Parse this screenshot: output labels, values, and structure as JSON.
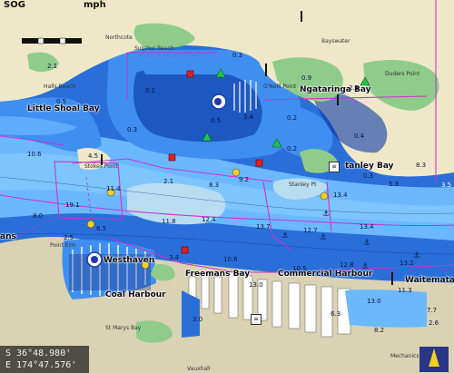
{
  "header": {
    "sog_label": "SOG",
    "speed_unit": "mph"
  },
  "position": {
    "lat": "S  36°48.980'",
    "lon": "E 174°47.576'"
  },
  "places": {
    "northcote": "Northcote",
    "sulphur_beach": "Sulphur Beach",
    "bayswater": "Bayswater",
    "halls_beach": "Halls Beach",
    "little_shoal_bay": "Little Shoal Bay",
    "stokes_point": "Stokes Point",
    "ngataringa_bay": "Ngataringa Bay",
    "duders_point": "Duders Point",
    "stanley_bay": "tanley Bay",
    "stanley_point": "Stanley Pt",
    "point_erin": "Point Erin",
    "westhaven": "Westhaven",
    "freemans_bay": "Freemans Bay",
    "commercial_harbour": "Commercial Harbour",
    "waitemata": "Waitemata",
    "coal_harbour": "Coal Harbour",
    "st_marys_bay": "St Marys Bay",
    "mechanics_bay": "Mechanics",
    "vauxhall": "Vauxhall",
    "ans": "ans",
    "oneill_point": "O'Neill Point"
  },
  "depths": {
    "d_2_1": "2.1",
    "d_0_3": "0.3",
    "d_0_9": "0.9",
    "d_0_1": "0.1",
    "d_2_3": "2.3",
    "d_0_5a": "0.5",
    "d_0_5b": "0.5",
    "d_0_3b": "0.3",
    "d_3_4": "3.4",
    "d_0_2a": "0.2",
    "d_0_2b": "0.2",
    "d_0_4": "0.4",
    "d_10_6": "10.6",
    "d_4_5": "4.5",
    "d_2_1b": "2.1",
    "d_8_3": "8.3",
    "d_9_2": "9.2",
    "d_5_3": "5.3",
    "d_3_5": "3.5",
    "d_11_4": "11.4",
    "d_13_4": "13.4",
    "d_19_1": "19.1",
    "d_8_0": "8.0",
    "d_11_8": "11.8",
    "d_12_4": "12.4",
    "d_13_7": "13.7",
    "d_12_7": "12.7",
    "d_13_4b": "13.4",
    "d_6_5": "6.5",
    "d_3_4b": "3.4",
    "d_10_6b": "10.6",
    "d_10_5": "10.5",
    "d_12_8": "12.8",
    "d_13_2": "13.2",
    "d_13_0": "13.0",
    "d_11_3": "11.3",
    "d_13_0b": "13.0",
    "d_3_0": "3.0",
    "d_6_3": "6.3",
    "d_7_7": "7.7",
    "d_8_2": "8.2",
    "d_2_6": "2.6",
    "d_8_3b": "8.3",
    "d_2_5": "2.5",
    "d_0_3c": "0.3"
  },
  "colors": {
    "land": "#efe8c8",
    "urban": "#d9d2b3",
    "park": "#8fcc8a",
    "deep_water": "#2a6fd8",
    "mid_water": "#3f8ff0",
    "channel_water": "#6cb8ff",
    "shallow_water": "#0a3aa8",
    "drying": "#7fd8ff",
    "route": "#cc33cc",
    "pier": "#ffffff"
  }
}
